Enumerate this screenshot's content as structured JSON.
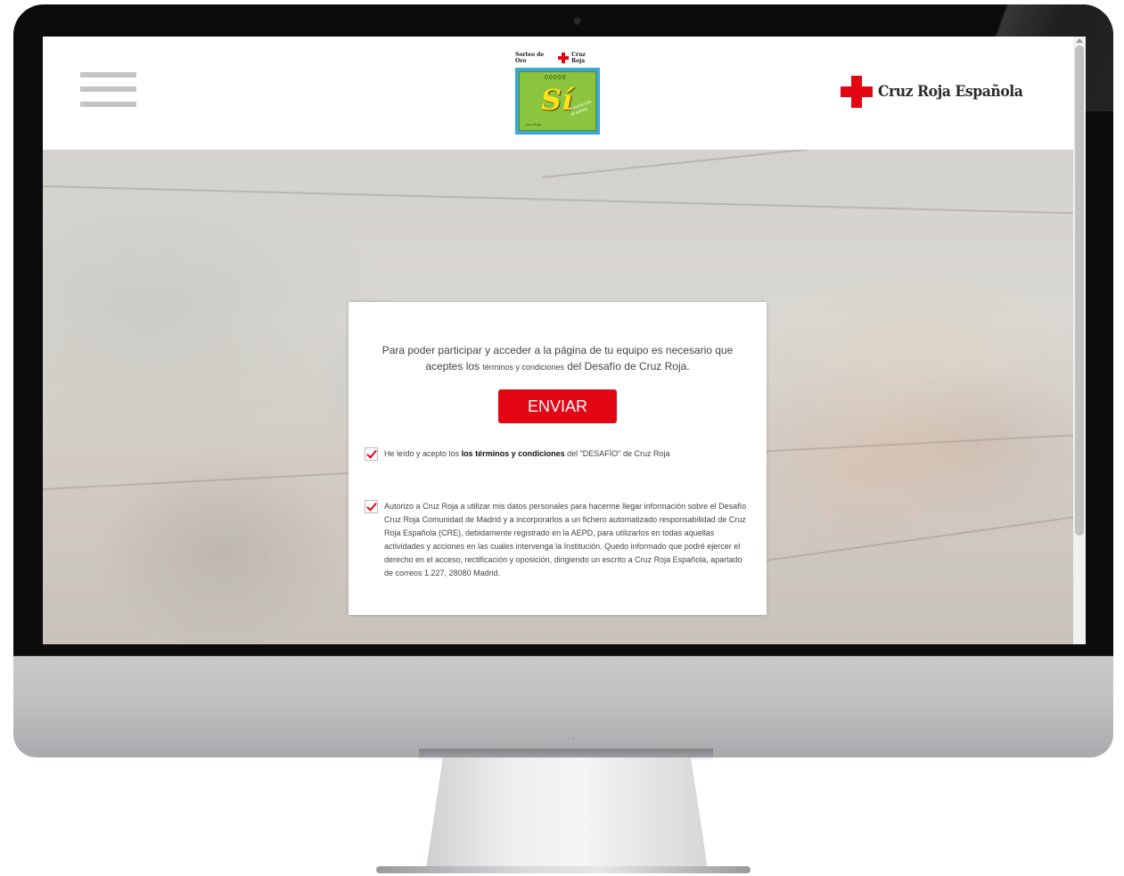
{
  "header": {
    "menu_icon": "hamburger-menu-icon",
    "center_logo": {
      "top_text_left": "Sorteo de Oro",
      "top_text_right": "Cruz Roja",
      "ticket_word": "Sí",
      "ticket_digits": "00000",
      "ticket_tag": "4 euros con el sorteo",
      "ticket_foot": "Cruz Roja"
    },
    "brand": {
      "name": "Cruz Roja Española",
      "color": "#e30613"
    }
  },
  "card": {
    "intro_before": "Para poder participar y acceder a la página de tu equipo es necesario que aceptes los ",
    "intro_small": "términos y condiciones",
    "intro_after": " del Desafío de Cruz Roja.",
    "send_label": "ENVIAR",
    "consent_terms": {
      "checked": true,
      "before": "He leído y acepto los ",
      "link": "los términos y condiciones",
      "after": " del \"DESAFÍO\" de Cruz Roja"
    },
    "consent_data": {
      "checked": true,
      "text": "Autorizo a Cruz Roja a utilizar mis datos personales para hacerme llegar información sobre el Desafío Cruz Roja Comunidad de Madrid y a incorporarlos a un fichero automatizado responsabilidad de Cruz Roja Española (CRE), debidamente registrado en la AEPD, para utilizarlos en todas aquellas actividades y acciones en las cuales intervenga la Institución. Quedo informado que podré ejercer el derecho en el acceso, rectificación y oposición, dirigiendo un escrito a Cruz Roja Española, apartado de correos 1.227, 28080 Madrid."
    }
  },
  "colors": {
    "accent": "#e30613",
    "ticket_bg": "#8bc53f",
    "ticket_frame": "#3aa7d7"
  }
}
